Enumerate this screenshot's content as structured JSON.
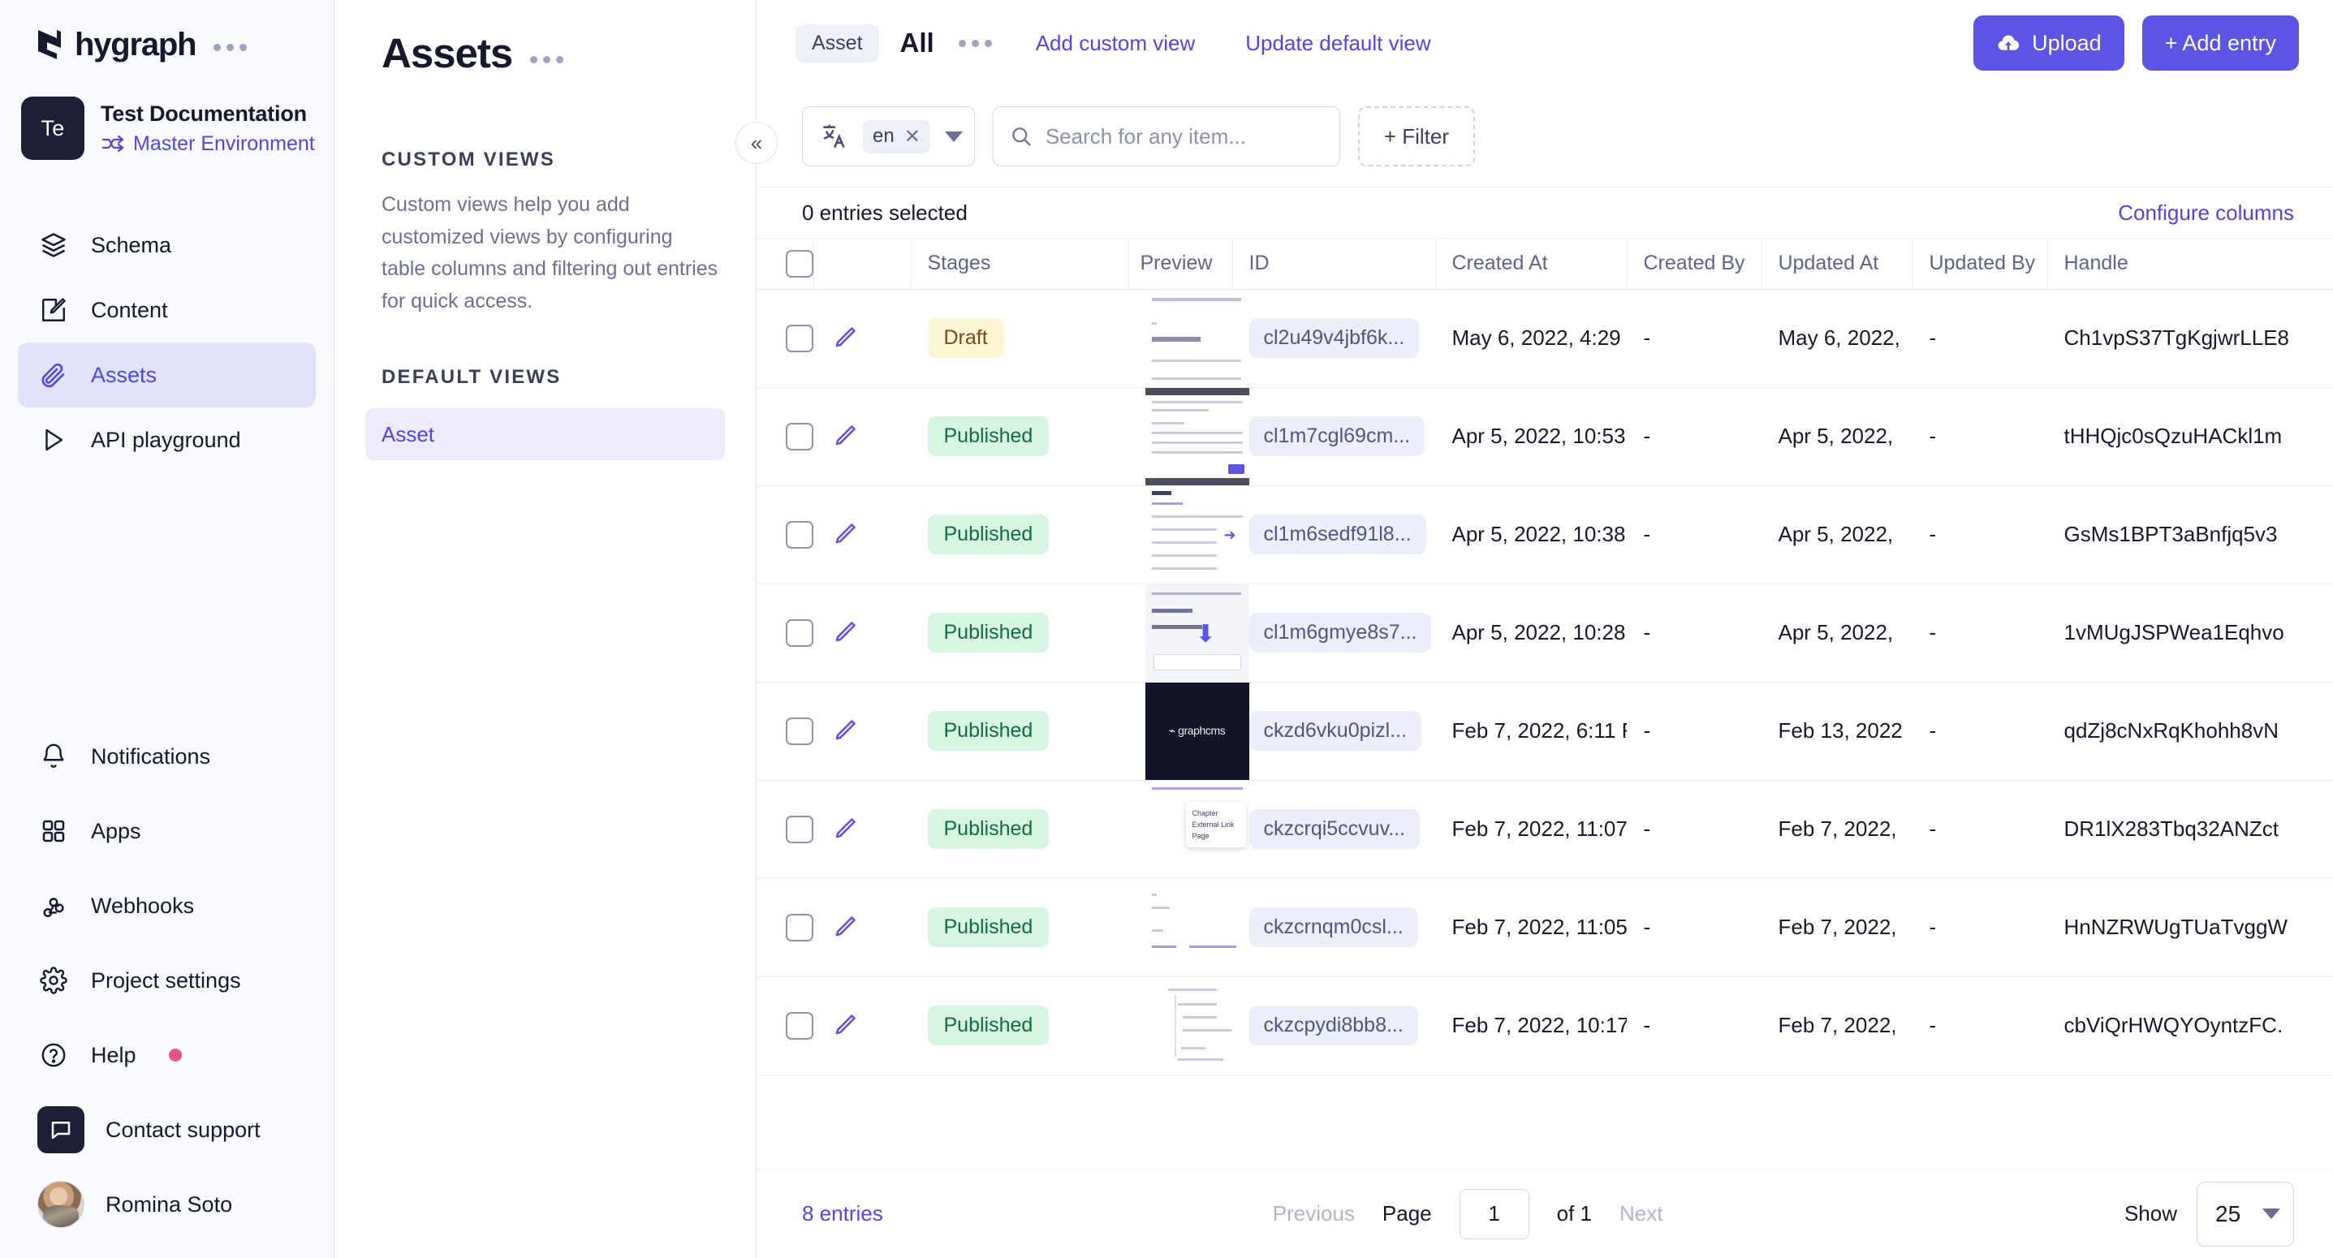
{
  "brand": {
    "name": "hygraph",
    "menu_dots": "..."
  },
  "project": {
    "avatar_initials": "Te",
    "name": "Test Documentation",
    "environment": "Master Environment"
  },
  "sidebar": {
    "items": [
      {
        "label": "Schema",
        "icon": "layers-icon",
        "active": false
      },
      {
        "label": "Content",
        "icon": "edit-square-icon",
        "active": false
      },
      {
        "label": "Assets",
        "icon": "paperclip-icon",
        "active": true
      },
      {
        "label": "API playground",
        "icon": "play-icon",
        "active": false
      }
    ],
    "bottom_items": [
      {
        "label": "Notifications",
        "icon": "bell-icon",
        "badge": false
      },
      {
        "label": "Apps",
        "icon": "grid-icon",
        "badge": false
      },
      {
        "label": "Webhooks",
        "icon": "webhook-icon",
        "badge": false
      },
      {
        "label": "Project settings",
        "icon": "gear-icon",
        "badge": false
      },
      {
        "label": "Help",
        "icon": "question-circle-icon",
        "badge": true
      },
      {
        "label": "Contact support",
        "icon": "chat-icon",
        "badge": false
      },
      {
        "label": "Romina Soto",
        "icon": "avatar",
        "badge": false
      }
    ]
  },
  "views_panel": {
    "title": "Assets",
    "custom_views_label": "CUSTOM VIEWS",
    "description": "Custom views help you add customized views by configuring table columns and filtering out entries for quick access.",
    "default_views_label": "DEFAULT VIEWS",
    "default_views": [
      {
        "label": "Asset",
        "active": true
      }
    ]
  },
  "topbar": {
    "model_chip": "Asset",
    "view_name": "All",
    "add_custom_view": "Add custom view",
    "update_default_view": "Update default view",
    "upload_button": "Upload",
    "add_entry_button": "+ Add entry"
  },
  "filterbar": {
    "collapse_icon": "«",
    "locale_value": "en",
    "locale_remove": "✕",
    "search_placeholder": "Search for any item...",
    "search_value": "",
    "filter_button": "+ Filter"
  },
  "selection_bar": {
    "selected_text": "0 entries selected",
    "configure_columns": "Configure columns"
  },
  "table": {
    "columns": [
      "",
      "",
      "Stages",
      "Preview",
      "ID",
      "Created At",
      "Created By",
      "Updated At",
      "Updated By",
      "Handle"
    ],
    "rows": [
      {
        "stage": "Draft",
        "id": "cl2u49v4jbf6k...",
        "created_at": "May 6, 2022, 4:29",
        "created_by": "-",
        "updated_at": "May 6, 2022, ",
        "updated_by": "-",
        "handle": "Ch1vpS37TgKgjwrLLE8"
      },
      {
        "stage": "Published",
        "id": "cl1m7cgl69cm...",
        "created_at": "Apr 5, 2022, 10:53",
        "created_by": "-",
        "updated_at": "Apr 5, 2022, ",
        "updated_by": "-",
        "handle": "tHHQjc0sQzuHACkl1m"
      },
      {
        "stage": "Published",
        "id": "cl1m6sedf91l8...",
        "created_at": "Apr 5, 2022, 10:38",
        "created_by": "-",
        "updated_at": "Apr 5, 2022, ",
        "updated_by": "-",
        "handle": "GsMs1BPT3aBnfjq5v3"
      },
      {
        "stage": "Published",
        "id": "cl1m6gmye8s7...",
        "created_at": "Apr 5, 2022, 10:28",
        "created_by": "-",
        "updated_at": "Apr 5, 2022, ",
        "updated_by": "-",
        "handle": "1vMUgJSPWea1Eqhvo"
      },
      {
        "stage": "Published",
        "id": "ckzd6vku0pizl...",
        "created_at": "Feb 7, 2022, 6:11 F",
        "created_by": "-",
        "updated_at": "Feb 13, 2022",
        "updated_by": "-",
        "handle": "qdZj8cNxRqKhohh8vN"
      },
      {
        "stage": "Published",
        "id": "ckzcrqi5ccvuv...",
        "created_at": "Feb 7, 2022, 11:07",
        "created_by": "-",
        "updated_at": "Feb 7, 2022, ",
        "updated_by": "-",
        "handle": "DR1lX283Tbq32ANZct"
      },
      {
        "stage": "Published",
        "id": "ckzcrnqm0csl...",
        "created_at": "Feb 7, 2022, 11:05",
        "created_by": "-",
        "updated_at": "Feb 7, 2022, ",
        "updated_by": "-",
        "handle": "HnNZRWUgTUaTvggW"
      },
      {
        "stage": "Published",
        "id": "ckzcpydi8bb8...",
        "created_at": "Feb 7, 2022, 10:17",
        "created_by": "-",
        "updated_at": "Feb 7, 2022, ",
        "updated_by": "-",
        "handle": "cbViQrHWQYOyntzFC."
      }
    ]
  },
  "footer": {
    "entries_count": "8 entries",
    "previous": "Previous",
    "page_label": "Page",
    "page_value": "1",
    "of_label": "of 1",
    "next": "Next",
    "show_label": "Show",
    "show_value": "25"
  },
  "colors": {
    "accent": "#5b54e6",
    "link": "#4f46e5",
    "draft_bg": "#fdf5d3",
    "draft_fg": "#7a4a17",
    "published_bg": "#d7f5e3",
    "published_fg": "#136c41",
    "badge_dot": "#e8548c",
    "sidebar_bg": "#f9fafd"
  }
}
